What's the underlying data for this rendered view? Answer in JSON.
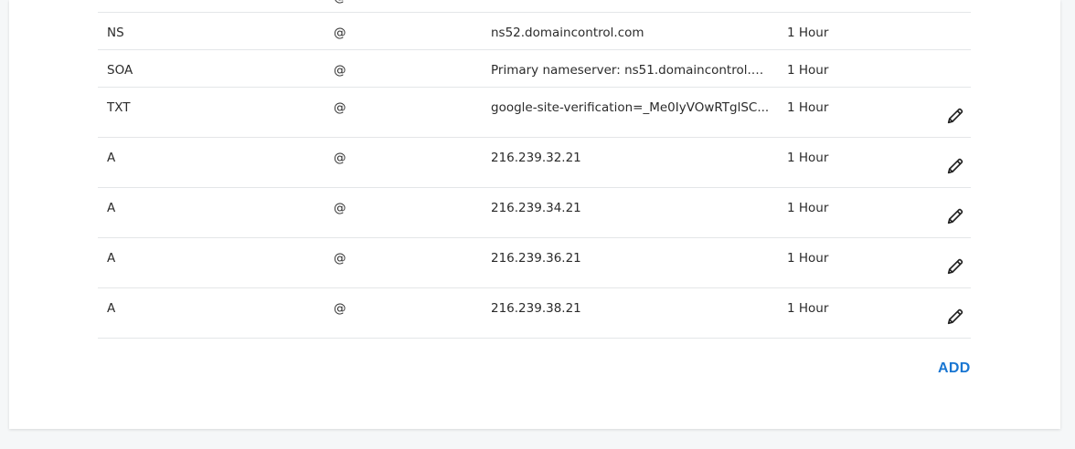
{
  "records": [
    {
      "type": "",
      "name": "@",
      "value": "",
      "ttl": "",
      "editable": false
    },
    {
      "type": "NS",
      "name": "@",
      "value": "ns52.domaincontrol.com",
      "ttl": "1 Hour",
      "editable": false
    },
    {
      "type": "SOA",
      "name": "@",
      "value": "Primary nameserver: ns51.domaincontrol.com.",
      "ttl": "1 Hour",
      "editable": false
    },
    {
      "type": "TXT",
      "name": "@",
      "value": "google-site-verification=_Me0IyVOwRTglSC...",
      "ttl": "1 Hour",
      "editable": true
    },
    {
      "type": "A",
      "name": "@",
      "value": "216.239.32.21",
      "ttl": "1 Hour",
      "editable": true
    },
    {
      "type": "A",
      "name": "@",
      "value": "216.239.34.21",
      "ttl": "1 Hour",
      "editable": true
    },
    {
      "type": "A",
      "name": "@",
      "value": "216.239.36.21",
      "ttl": "1 Hour",
      "editable": true
    },
    {
      "type": "A",
      "name": "@",
      "value": "216.239.38.21",
      "ttl": "1 Hour",
      "editable": true
    }
  ],
  "actions": {
    "add_label": "ADD"
  },
  "icons": {
    "edit": "pencil-icon"
  },
  "colors": {
    "accent": "#1976d2",
    "divider": "#e4e6e8",
    "text": "#2b2b2b"
  }
}
